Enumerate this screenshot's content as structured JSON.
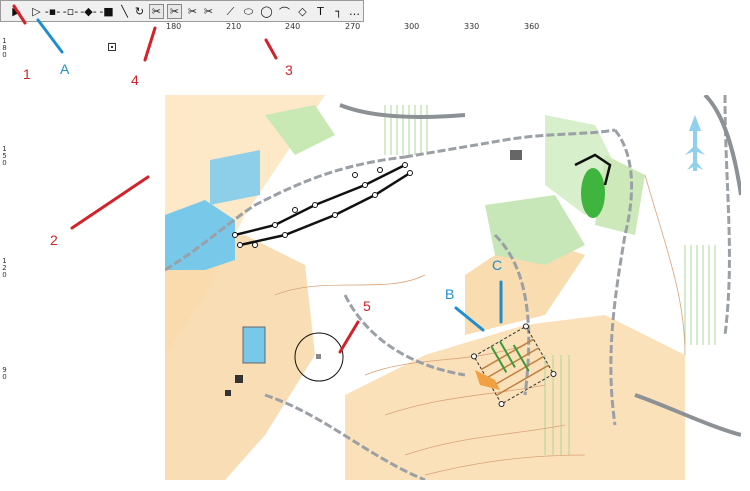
{
  "toolbar": {
    "tools": [
      {
        "id": "select",
        "icon": "▶"
      },
      {
        "id": "select-outline",
        "icon": "▷"
      },
      {
        "id": "point",
        "icon": "-▪-"
      },
      {
        "id": "point2",
        "icon": "-▫-"
      },
      {
        "id": "point3",
        "icon": "-◆-"
      },
      {
        "id": "point4",
        "icon": "-■"
      },
      {
        "id": "draw-path",
        "icon": "╲"
      },
      {
        "id": "rotate",
        "icon": "↻"
      },
      {
        "id": "cut",
        "icon": "✂"
      },
      {
        "id": "cut2",
        "icon": "✂"
      },
      {
        "id": "cut3",
        "icon": "✂"
      },
      {
        "id": "cut4",
        "icon": "✂"
      },
      {
        "id": "curve",
        "icon": "⟋"
      },
      {
        "id": "ellipse",
        "icon": "⬭"
      },
      {
        "id": "circle",
        "icon": "◯"
      },
      {
        "id": "zigzag",
        "icon": "⌒"
      },
      {
        "id": "polygon",
        "icon": "◇"
      },
      {
        "id": "tee",
        "icon": "T"
      },
      {
        "id": "line-dots",
        "icon": "┐"
      },
      {
        "id": "more",
        "icon": "…"
      }
    ]
  },
  "ruler": {
    "top": [
      "180",
      "210",
      "240",
      "270",
      "300",
      "330",
      "360"
    ],
    "left": [
      {
        "label": "180"
      },
      {
        "label": "150"
      },
      {
        "label": "120"
      },
      {
        "label": "90"
      }
    ]
  },
  "annotations": {
    "n1": "1",
    "nA": "A",
    "n4": "4",
    "n3": "3",
    "n2": "2",
    "n5": "5",
    "nB": "B",
    "nC": "C"
  },
  "colors": {
    "red": "#d2232a",
    "blue": "#1e8ed0",
    "green": "#5cb85c",
    "orange": "#f5c77e",
    "water": "#78c8ea",
    "path_gray": "#9aa0a6"
  }
}
